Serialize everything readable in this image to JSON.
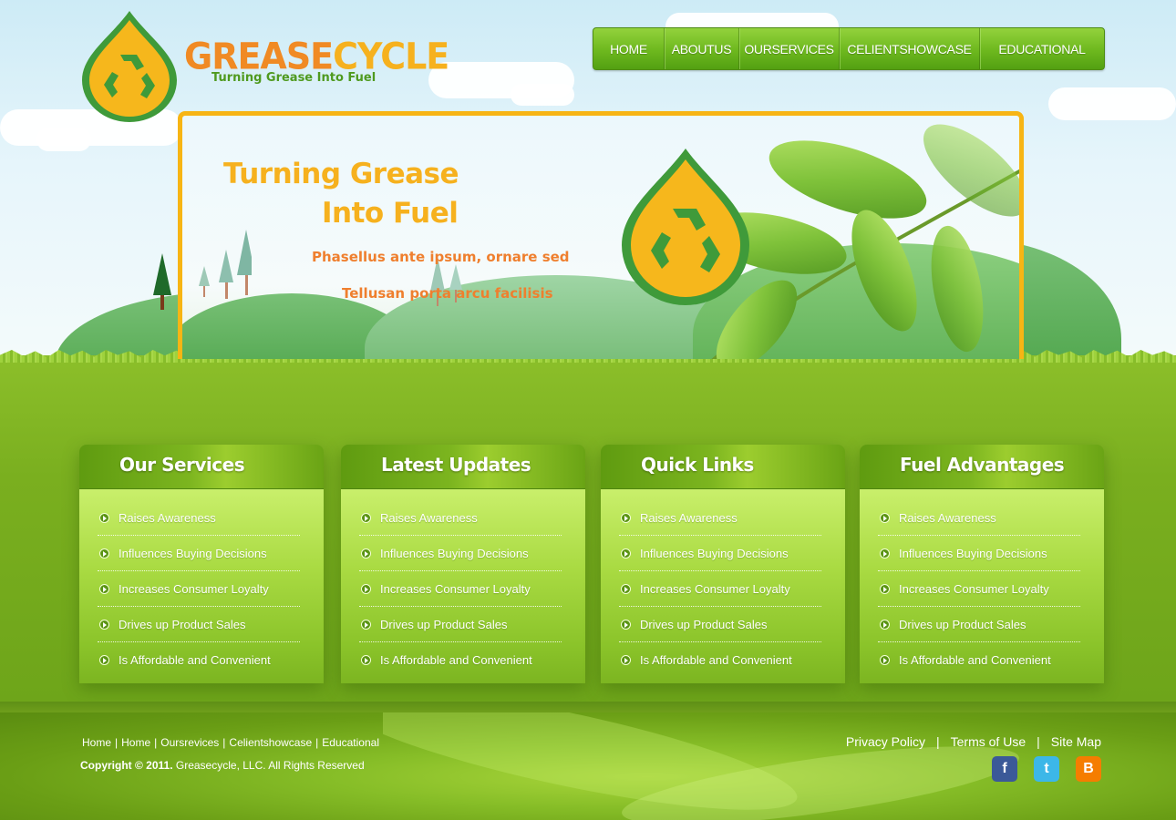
{
  "brand": {
    "name_part1": "GREASE",
    "name_part2": "CYCLE",
    "tagline": "Turning Grease Into Fuel",
    "colors": {
      "orange": "#f08a24",
      "yellow": "#f6b11e",
      "green": "#4f9a1f"
    }
  },
  "nav": {
    "items": [
      {
        "label": "HOME"
      },
      {
        "label": "ABOUTUS"
      },
      {
        "label": "OURSERVICES"
      },
      {
        "label": "CELIENTSHOWCASE"
      },
      {
        "label": "EDUCATIONAL"
      }
    ]
  },
  "banner": {
    "headline_line1": "Turning Grease",
    "headline_line2": "Into Fuel",
    "sub_line1": "Phasellus ante ipsum, ornare sed",
    "sub_line2": "Tellusan porta arcu facilisis"
  },
  "boxes": [
    {
      "title": "Our Services",
      "items": [
        "Raises Awareness",
        "Influences Buying Decisions",
        "Increases Consumer Loyalty",
        "Drives up Product Sales",
        "Is Affordable and Convenient"
      ]
    },
    {
      "title": "Latest Updates",
      "items": [
        "Raises Awareness",
        "Influences Buying Decisions",
        "Increases Consumer Loyalty",
        "Drives up Product Sales",
        "Is Affordable and Convenient"
      ]
    },
    {
      "title": "Quick Links",
      "items": [
        "Raises Awareness",
        "Influences Buying Decisions",
        "Increases Consumer Loyalty",
        "Drives up Product Sales",
        "Is Affordable and Convenient"
      ]
    },
    {
      "title": "Fuel Advantages",
      "items": [
        "Raises Awareness",
        "Influences Buying Decisions",
        "Increases Consumer Loyalty",
        "Drives up Product Sales",
        "Is Affordable and Convenient"
      ]
    }
  ],
  "footer": {
    "links": [
      "Home",
      "Home",
      "Oursrevices",
      "Celientshowcase",
      "Educational"
    ],
    "separator": "|",
    "copyright_bold": "Copyright © 2011.",
    "copyright_rest": " Greasecycle, LLC. All Rights Reserved",
    "legal": [
      "Privacy Policy",
      "Terms of Use",
      "Site Map"
    ],
    "social": [
      {
        "icon": "facebook-icon",
        "glyph": "f",
        "color": "#3b5998"
      },
      {
        "icon": "twitter-icon",
        "glyph": "t",
        "color": "#3cb7e8"
      },
      {
        "icon": "blogger-icon",
        "glyph": "B",
        "color": "#f57d00"
      }
    ]
  }
}
